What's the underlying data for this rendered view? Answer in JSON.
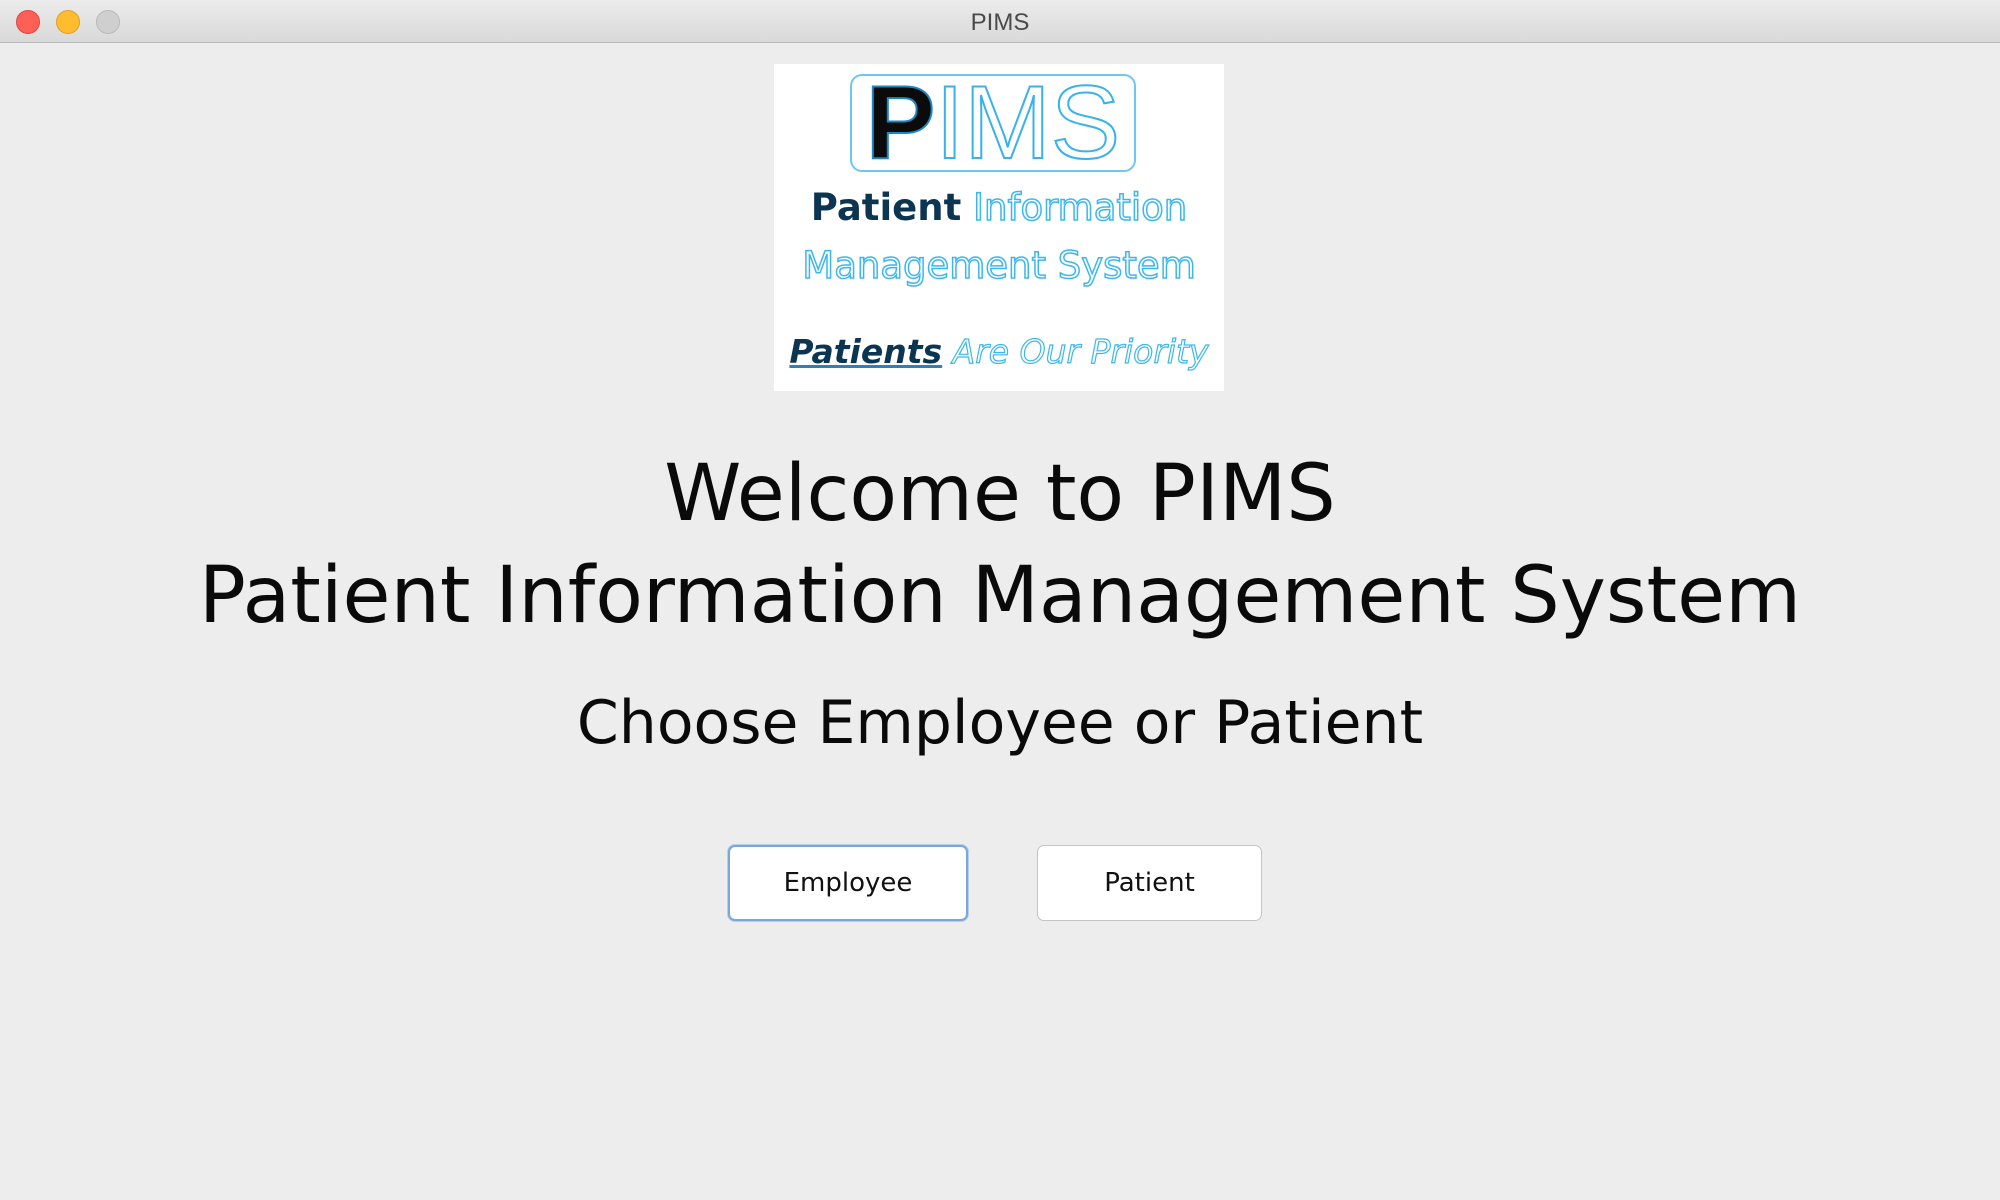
{
  "window": {
    "title": "PIMS",
    "controls": [
      "close",
      "minimize",
      "maximize"
    ]
  },
  "logo": {
    "acronym_first": "P",
    "acronym_rest": "IMS",
    "line1_dark": "Patient",
    "line1_outline": "Information",
    "line2_outline": "Management System",
    "tagline_dark": "Patients",
    "tagline_outline": "Are Our Priority"
  },
  "main": {
    "welcome": "Welcome to PIMS",
    "subtitle": "Patient Information Management System",
    "prompt": "Choose Employee or Patient"
  },
  "buttons": {
    "employee_label": "Employee",
    "patient_label": "Patient"
  },
  "colors": {
    "close": "#fe5f57",
    "minimize": "#febc2e",
    "maximize": "#cfcfcf",
    "logo_accent": "#37b2ec",
    "logo_dark": "#0c3552",
    "focus_ring": "#7aa6d9"
  }
}
